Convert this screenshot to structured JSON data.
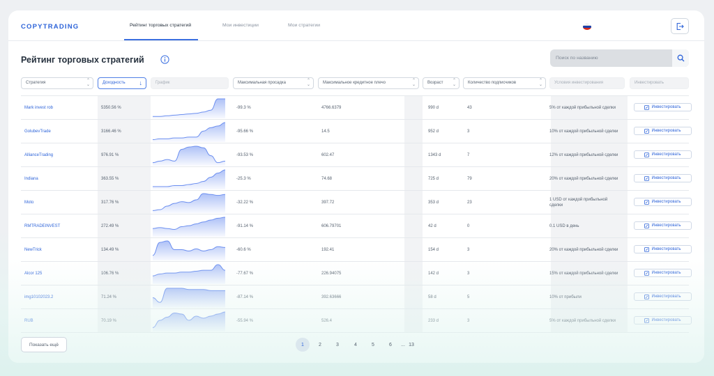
{
  "brand": "COPYTRADING",
  "nav": {
    "tabs": [
      "Рейтинг торговых стратегий",
      "Мои инвестиции",
      "Мои стратегии"
    ],
    "active_tab": 0
  },
  "page_title": "Рейтинг торговых стратегий",
  "search": {
    "placeholder": "Поиск по названию"
  },
  "filters": [
    {
      "label": "Стратегия",
      "state": "sortable"
    },
    {
      "label": "Доходность",
      "state": "active"
    },
    {
      "label": "График",
      "state": "disabled"
    },
    {
      "label": "Максимальная просадка",
      "state": "sortable"
    },
    {
      "label": "Максимальное кредитное плечо",
      "state": "sortable"
    },
    {
      "label": "Возраст",
      "state": "sortable"
    },
    {
      "label": "Количество подписчиков",
      "state": "sortable"
    },
    {
      "label": "Условия инвестирования",
      "state": "disabled"
    },
    {
      "label": "Инвестировать",
      "state": "disabled"
    }
  ],
  "invest_label": "Инвестировать",
  "rows": [
    {
      "name": "Mark invest rob",
      "yield": "5350.56 %",
      "drawdown": "-99.3 %",
      "leverage": "4766.6379",
      "age": "990 d",
      "subs": "43",
      "cond": "5% от каждой прибыльной сделки",
      "spark": [
        2,
        2,
        3,
        4,
        5,
        6,
        7,
        9,
        12,
        30,
        30
      ]
    },
    {
      "name": "GolubevTrade",
      "yield": "3166.46 %",
      "drawdown": "-95.66 %",
      "leverage": "14.5",
      "age": "952 d",
      "subs": "3",
      "cond": "10% от каждой прибыльной сделки",
      "spark": [
        2,
        3,
        3,
        4,
        4,
        5,
        5,
        12,
        16,
        18,
        22
      ]
    },
    {
      "name": "AllianceTrading",
      "yield": "976.91 %",
      "drawdown": "-93.53 %",
      "leverage": "602.47",
      "age": "1343 d",
      "subs": "7",
      "cond": "12% от каждой прибыльной сделки",
      "spark": [
        3,
        5,
        7,
        5,
        20,
        23,
        24,
        22,
        12,
        3,
        5
      ]
    },
    {
      "name": "Indiana",
      "yield": "363.55 %",
      "drawdown": "-25.3 %",
      "leverage": "74.68",
      "age": "725 d",
      "subs": "79",
      "cond": "20% от каждой прибыльной сделки",
      "spark": [
        2,
        2,
        2,
        3,
        3,
        4,
        5,
        7,
        11,
        15,
        18
      ]
    },
    {
      "name": "Moto",
      "yield": "317.76 %",
      "drawdown": "-32.22 %",
      "leverage": "397.72",
      "age": "353 d",
      "subs": "23",
      "cond": "1 USD от каждой прибыльной сделки",
      "spark": [
        2,
        3,
        7,
        10,
        12,
        11,
        14,
        21,
        20,
        19,
        20
      ]
    },
    {
      "name": "RMTRADEINVEST",
      "yield": "272.49 %",
      "drawdown": "-91.14 %",
      "leverage": "606.79701",
      "age": "42 d",
      "subs": "0",
      "cond": "0.1 USD в день",
      "spark": [
        8,
        9,
        8,
        7,
        10,
        11,
        13,
        15,
        17,
        19,
        20
      ]
    },
    {
      "name": "NewTrick",
      "yield": "134.49 %",
      "drawdown": "-60.6 %",
      "leverage": "192.41",
      "age": "154 d",
      "subs": "3",
      "cond": "20% от каждой прибыльной сделки",
      "spark": [
        6,
        24,
        26,
        14,
        14,
        12,
        15,
        12,
        14,
        18,
        17
      ]
    },
    {
      "name": "Alcor 125",
      "yield": "106.76 %",
      "drawdown": "-77.67 %",
      "leverage": "226.94075",
      "age": "142 d",
      "subs": "3",
      "cond": "15% от каждой прибыльной сделки",
      "spark": [
        8,
        10,
        11,
        11,
        12,
        12,
        13,
        14,
        14,
        20,
        14
      ]
    },
    {
      "name": "img10102023.2",
      "yield": "71.24 %",
      "drawdown": "-87.14 %",
      "leverage": "392.63666",
      "age": "58 d",
      "subs": "5",
      "cond": "10% от прибыли",
      "spark": [
        8,
        4,
        16,
        16,
        16,
        15,
        15,
        15,
        14,
        14,
        14
      ]
    },
    {
      "name": "RUB",
      "yield": "70.19 %",
      "drawdown": "-55.94 %",
      "leverage": "526.4",
      "age": "233 d",
      "subs": "3",
      "cond": "5% от каждой прибыльной сделки",
      "spark": [
        3,
        10,
        13,
        17,
        16,
        10,
        14,
        12,
        14,
        16,
        18
      ]
    }
  ],
  "footer": {
    "show_more": "Показать ещё",
    "pages": [
      "1",
      "2",
      "3",
      "4",
      "5",
      "6",
      "...",
      "13"
    ],
    "current_page": "1"
  },
  "colors": {
    "accent": "#2e64d9",
    "spark_blue": "#6b8ef0",
    "spark_red": "#e57792"
  },
  "icons": [
    "logout-icon",
    "info-icon",
    "search-icon",
    "sort-icon",
    "invest-icon",
    "russia-flag-icon"
  ]
}
